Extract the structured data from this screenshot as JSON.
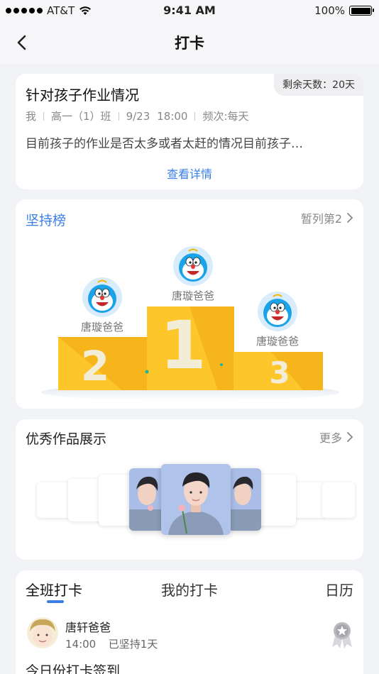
{
  "status_bar": {
    "carrier": "AT&T",
    "time": "9:41 AM",
    "battery": "100%"
  },
  "nav": {
    "title": "打卡"
  },
  "task": {
    "remaining": "剩余天数：20天",
    "title": "针对孩子作业情况",
    "meta": {
      "who": "我",
      "class": "高一（1）班",
      "date": "9/23",
      "time": "18:00",
      "frequency": "频次:每天"
    },
    "description": "目前孩子的作业是否太多或者太赶的情况目前孩子…",
    "detail_link": "查看详情"
  },
  "leaderboard": {
    "title": "坚持榜",
    "my_rank": "暂列第2",
    "first": {
      "name": "唐璇爸爸",
      "rank": "1"
    },
    "second": {
      "name": "唐璇爸爸",
      "rank": "2"
    },
    "third": {
      "name": "唐璇爸爸",
      "rank": "3"
    },
    "colors": {
      "podium": "#fdc72b",
      "podium_shade": "#f7b51c",
      "accent": "#3a7fe6"
    }
  },
  "works": {
    "title": "优秀作品展示",
    "more": "更多"
  },
  "checkin": {
    "tabs": [
      "全班打卡",
      "我的打卡",
      "日历"
    ],
    "entry": {
      "name": "唐轩爸爸",
      "time": "14:00",
      "streak": "已坚持1天",
      "title": "今日份打卡签到"
    }
  },
  "icons": [
    "back-arrow-icon",
    "chevron-right-icon",
    "wifi-icon",
    "battery-icon",
    "medal-icon"
  ]
}
